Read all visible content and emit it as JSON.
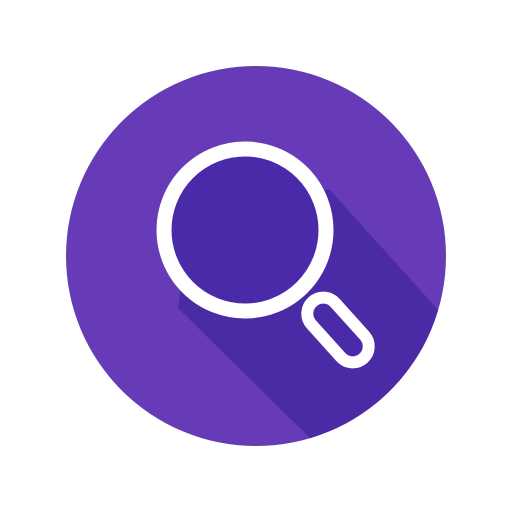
{
  "app_icon": {
    "name": "search-icon",
    "colors": {
      "background": "#ffffff",
      "circle": "#673ab7",
      "shadow": "#4b2aa5",
      "glass_fill": "#4a2aa8",
      "stroke": "#ffffff"
    }
  }
}
